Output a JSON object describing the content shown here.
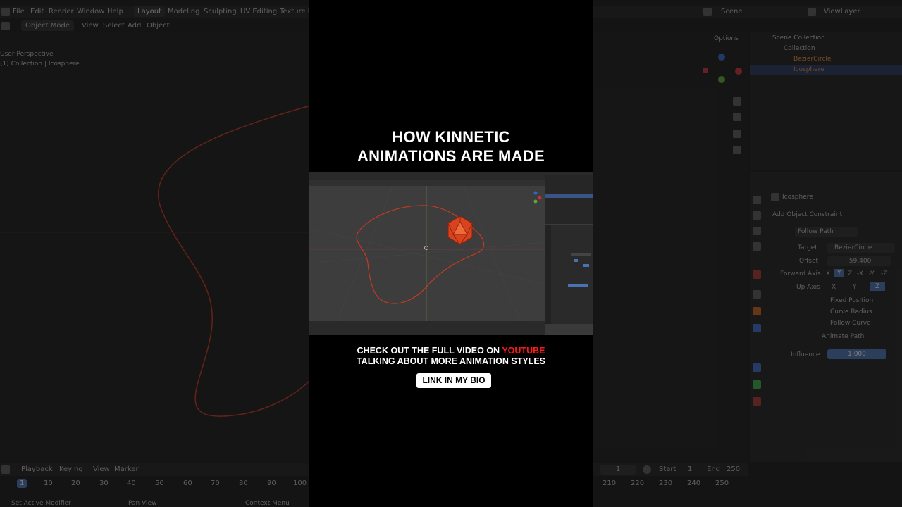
{
  "blender": {
    "menu": [
      "File",
      "Edit",
      "Render",
      "Window",
      "Help"
    ],
    "workspaces": [
      "Layout",
      "Modeling",
      "Sculpting",
      "UV Editing",
      "Texture Pa"
    ],
    "mode": "Object Mode",
    "view_menu": [
      "View",
      "Select",
      "Add",
      "Object"
    ],
    "viewport_info": [
      "User Perspective",
      "(1) Collection | Icosphere"
    ],
    "scene_label": "Scene",
    "viewlayer_label": "ViewLayer",
    "options_label": "Options",
    "outliner": {
      "root": "Scene Collection",
      "collection": "Collection",
      "items": [
        "BezierCircle",
        "Icosphere"
      ]
    },
    "properties": {
      "object_name": "Icosphere",
      "add_constraint": "Add Object Constraint",
      "constraint_name": "Follow Path",
      "target_label": "Target",
      "target_value": "BezierCircle",
      "offset_label": "Offset",
      "offset_value": "-59.400",
      "forward_axis_label": "Forward Axis",
      "forward_axes": [
        "X",
        "Y",
        "Z",
        "-X",
        "-Y",
        "-Z"
      ],
      "up_axis_label": "Up Axis",
      "up_axes": [
        "X",
        "Y",
        "Z"
      ],
      "checkboxes": [
        "Fixed Position",
        "Curve Radius",
        "Follow Curve"
      ],
      "animate_path": "Animate Path",
      "influence_label": "Influence",
      "influence_value": "1.000"
    },
    "timeline": {
      "menus": [
        "Playback",
        "Keying",
        "View",
        "Marker"
      ],
      "frame_current": "1",
      "ticks_left": [
        "1",
        "10",
        "20",
        "30",
        "40",
        "50",
        "60",
        "70",
        "80",
        "90",
        "100"
      ],
      "ticks_right": [
        "210",
        "220",
        "230",
        "240",
        "250"
      ],
      "start_label": "Start",
      "start_value": "1",
      "end_label": "End",
      "end_value": "250",
      "current_right": "1"
    },
    "status": [
      "Set Active Modifier",
      "Pan View",
      "Context Menu"
    ]
  },
  "overlay": {
    "title_line1": "HOW KINNETIC",
    "title_line2": "ANIMATIONS ARE MADE",
    "cta_line1_prefix": "CHECK OUT THE FULL VIDEO ON ",
    "cta_line1_highlight": "YOUTUBE",
    "cta_line2": "TALKING ABOUT MORE ANIMATION STYLES",
    "bio_button": "LINK IN MY BIO"
  },
  "colors": {
    "accent_blue": "#4772b3",
    "curve_red": "#c8351e",
    "youtube_red": "#ff1a1a"
  }
}
